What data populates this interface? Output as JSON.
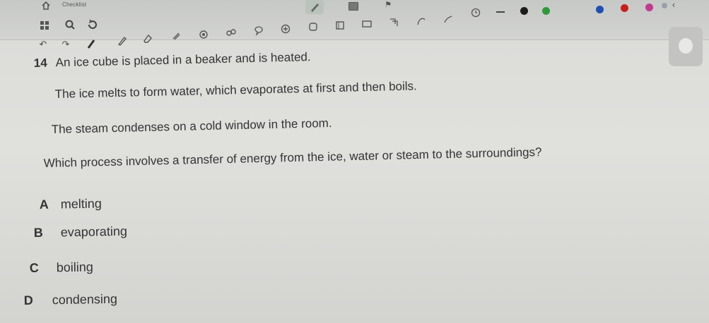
{
  "toolbar": {
    "checklist_label": "Checklist",
    "icons_row1": [
      "home-icon",
      "grid-icon",
      "search-icon",
      "refresh-icon",
      "pen-icon",
      "square-icon",
      "flag-icon"
    ],
    "icons_row2": [
      "undo-icon",
      "redo-icon",
      "pen-tool-icon",
      "highlighter-icon",
      "eraser-icon",
      "lasso-icon",
      "target-icon",
      "link-icon",
      "speech-bubble-icon",
      "plus-circle-icon",
      "shape-icon",
      "rectangle-icon",
      "square-icon",
      "crop-icon",
      "curve-icon",
      "curve-icon-2",
      "clock-icon"
    ],
    "colors": [
      "#1c1c1c",
      "#2e9a3a",
      "#1f4fb5",
      "#c81d1d",
      "#c03a8f",
      "#9aa0a8"
    ]
  },
  "question": {
    "number": "14",
    "lines": [
      "An ice cube is placed in a beaker and is heated.",
      "The ice melts to form water, which evaporates at first and then boils.",
      "The steam condenses on a cold window in the room.",
      "Which process involves a transfer of energy from the ice, water or steam to the surroundings?"
    ],
    "options": [
      {
        "letter": "A",
        "text": "melting"
      },
      {
        "letter": "B",
        "text": "evaporating"
      },
      {
        "letter": "C",
        "text": "boiling"
      },
      {
        "letter": "D",
        "text": "condensing"
      }
    ]
  }
}
